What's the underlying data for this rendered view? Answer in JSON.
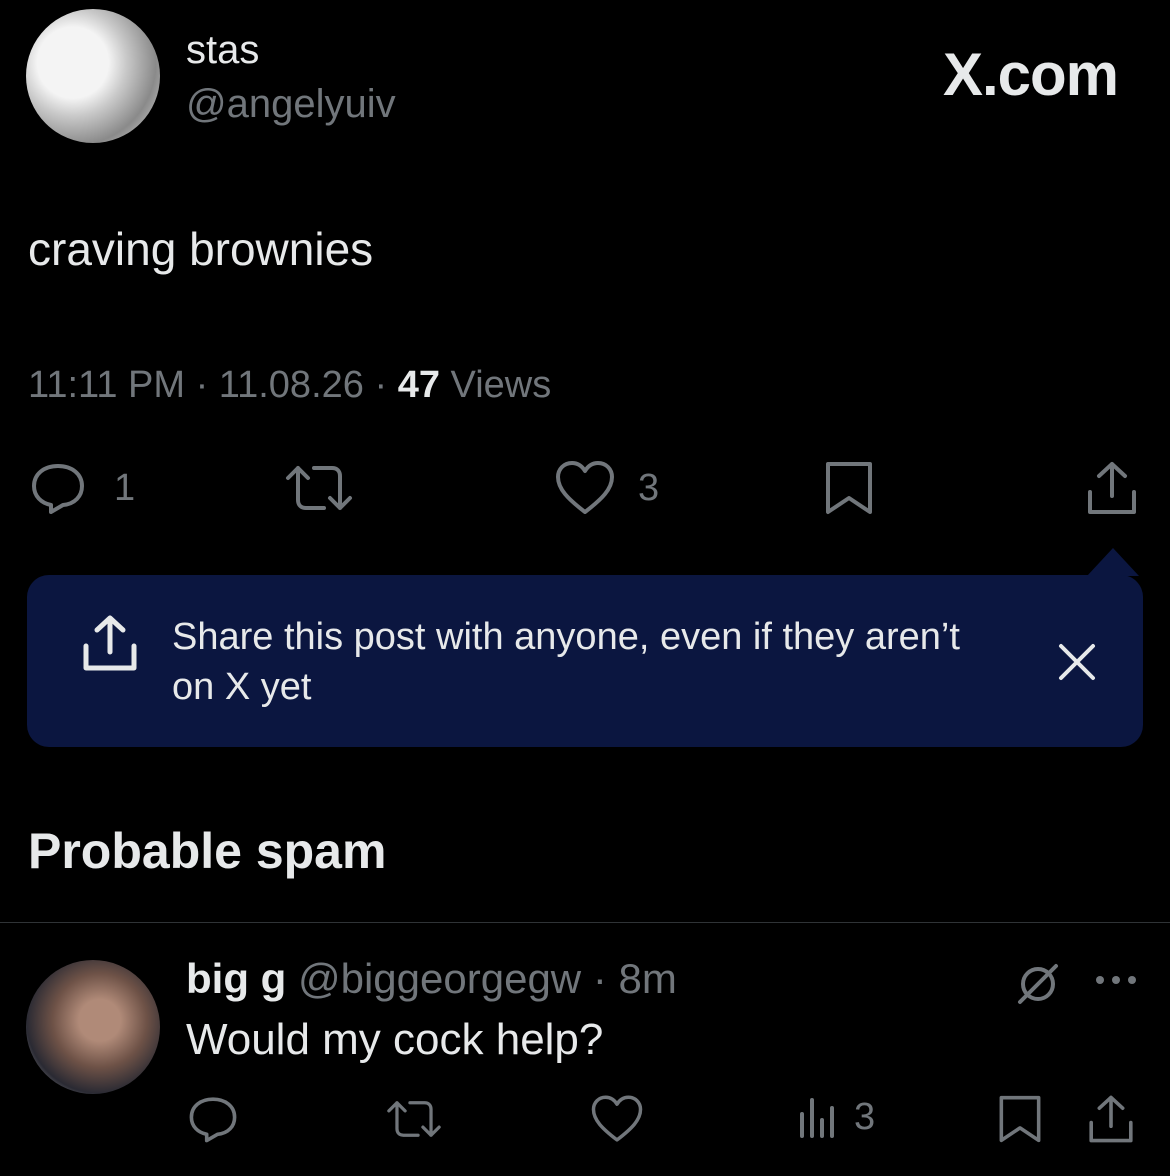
{
  "post": {
    "author_name": "stas",
    "author_handle": "@angelyuiv",
    "brand": "X.com",
    "text": "craving brownies",
    "time": "11:11 PM",
    "date": "11.08.26",
    "views_count": "47",
    "views_label": "Views",
    "separator": "·",
    "replies": "1",
    "likes": "3"
  },
  "banner": {
    "text": "Share this post with anyone, even if they aren’t on X yet"
  },
  "section": {
    "heading": "Probable spam"
  },
  "reply": {
    "author_name": "big g",
    "author_handle": "@biggeorgegw",
    "separator": "·",
    "age": "8m",
    "text": "Would my cock help?",
    "views": "3"
  },
  "icons": {
    "reply": "reply-icon",
    "repost": "repost-icon",
    "like": "heart-icon",
    "bookmark": "bookmark-icon",
    "share": "share-icon",
    "close": "close-icon",
    "grok": "grok-icon",
    "more": "more-icon",
    "views": "views-icon"
  },
  "colors": {
    "background": "#000000",
    "text": "#e7e9ea",
    "muted": "#71767b",
    "banner": "#0b1640"
  }
}
